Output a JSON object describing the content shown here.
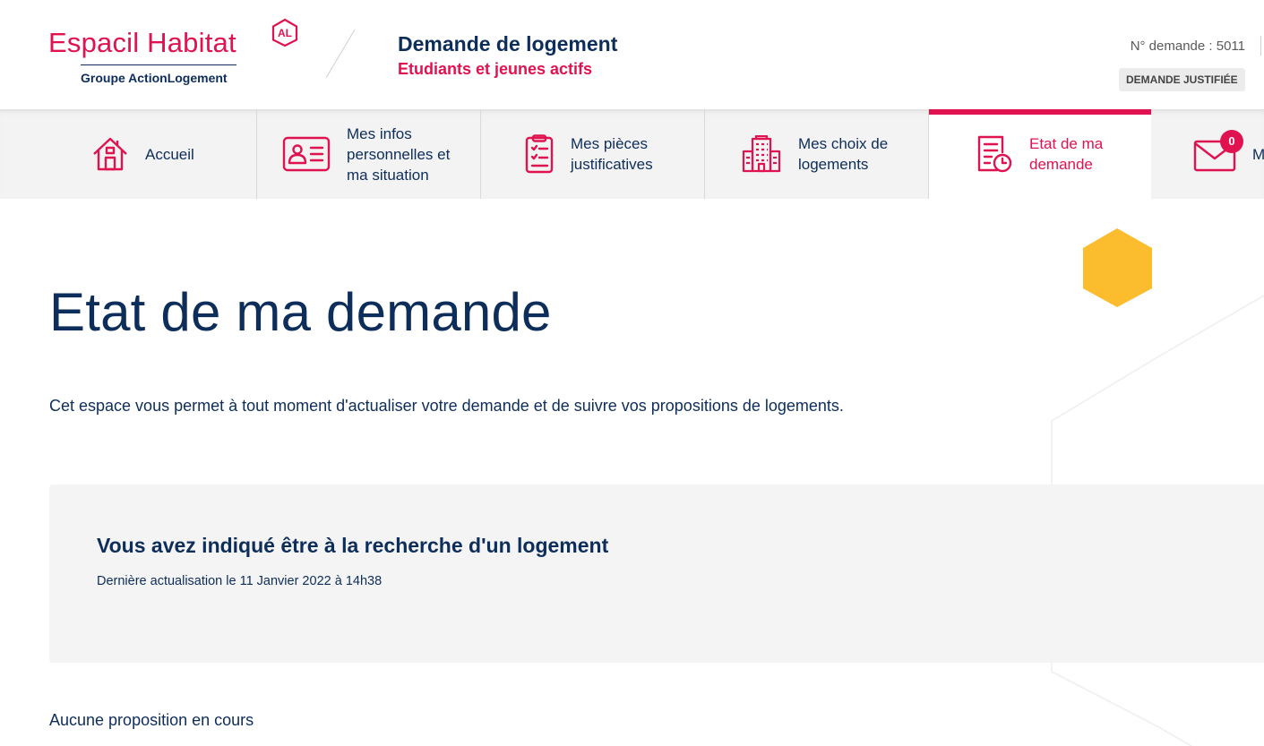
{
  "header": {
    "brand_name": "Espacil Habitat",
    "brand_badge": "AL",
    "brand_group_prefix": "Groupe Action",
    "brand_group_suffix": "Logement",
    "title": "Demande de logement",
    "subtitle": "Etudiants et jeunes actifs",
    "request_number": "N° demande : 5011",
    "status_badge": "DEMANDE JUSTIFIÉE"
  },
  "nav": {
    "items": [
      {
        "label": "Accueil",
        "icon": "home-icon",
        "active": false
      },
      {
        "label": "Mes infos personnelles et ma situation",
        "icon": "id-card-icon",
        "active": false
      },
      {
        "label": "Mes pièces justificatives",
        "icon": "clipboard-icon",
        "active": false
      },
      {
        "label": "Mes choix de logements",
        "icon": "building-icon",
        "active": false
      },
      {
        "label": "Etat de ma demande",
        "icon": "document-clock-icon",
        "active": true
      },
      {
        "label": "M",
        "icon": "mail-icon",
        "active": false,
        "badge": "0"
      }
    ]
  },
  "main": {
    "title": "Etat de ma demande",
    "intro": "Cet espace vous permet à tout moment d'actualiser votre demande et de suivre vos propositions de logements.",
    "status_heading": "Vous avez indiqué être à la recherche d'un logement",
    "status_updated": "Dernière actualisation le 11 Janvier 2022 à 14h38",
    "no_proposal": "Aucune proposition en cours"
  },
  "colors": {
    "brand_red": "#e0124f",
    "navy": "#0d2d5b",
    "decor_yellow": "#fbbc2e",
    "panel_gray": "#f4f4f4",
    "nav_gray": "#f3f3f3"
  }
}
